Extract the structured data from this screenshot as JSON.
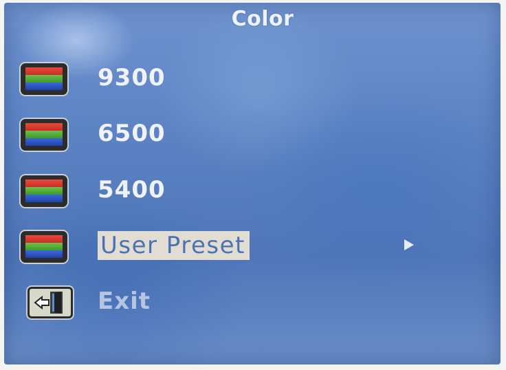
{
  "menu": {
    "title": "Color",
    "items": [
      {
        "label": "9300",
        "icon": "color-bars-icon"
      },
      {
        "label": "6500",
        "icon": "color-bars-icon"
      },
      {
        "label": "5400",
        "icon": "color-bars-icon"
      },
      {
        "label": "User Preset",
        "icon": "color-bars-icon",
        "selected": true,
        "submenu": "right-arrow-icon"
      },
      {
        "label": "Exit",
        "icon": "exit-door-icon"
      }
    ]
  },
  "colors": {
    "background": "#5c83c3",
    "highlight": "#e2ddd3",
    "highlight_text": "#4d72b4",
    "text": "#f0f2f6"
  }
}
